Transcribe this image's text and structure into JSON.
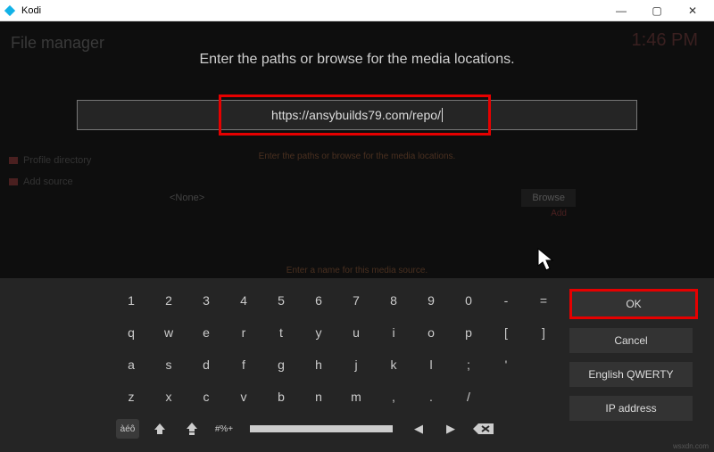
{
  "window": {
    "title": "Kodi",
    "min": "—",
    "max": "▢",
    "close": "✕"
  },
  "bg": {
    "header": "File manager",
    "time": "1:46 PM",
    "profile": "Profile directory",
    "addsrc": "Add source",
    "instruction": "Enter the paths or browse for the media locations.",
    "none": "<None>",
    "browse": "Browse",
    "add": "Add",
    "entername": "Enter a name for this media source."
  },
  "dialog": {
    "title": "Enter the paths or browse for the media locations.",
    "input_value": "https://ansybuilds79.com/repo/"
  },
  "keyboard": {
    "row1": [
      "1",
      "2",
      "3",
      "4",
      "5",
      "6",
      "7",
      "8",
      "9",
      "0",
      "-",
      "=",
      "`"
    ],
    "row2": [
      "q",
      "w",
      "e",
      "r",
      "t",
      "y",
      "u",
      "i",
      "o",
      "p",
      "[",
      "]",
      "\\"
    ],
    "row3": [
      "a",
      "s",
      "d",
      "f",
      "g",
      "h",
      "j",
      "k",
      "l",
      ";",
      "'"
    ],
    "row4": [
      "z",
      "x",
      "c",
      "v",
      "b",
      "n",
      "m",
      ",",
      ".",
      "/"
    ],
    "special_accents": "àéô",
    "shift": "⇧",
    "caps": "⇪",
    "symbols": "#%+",
    "left": "◀",
    "right": "▶"
  },
  "buttons": {
    "ok": "OK",
    "cancel": "Cancel",
    "layout": "English QWERTY",
    "ip": "IP address"
  },
  "watermark": "wsxdn.com"
}
